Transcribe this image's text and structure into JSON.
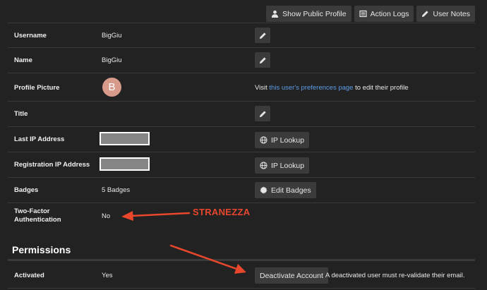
{
  "toolbar": {
    "show_public_profile": "Show Public Profile",
    "action_logs": "Action Logs",
    "user_notes": "User Notes"
  },
  "profile": {
    "username": {
      "label": "Username",
      "value": "BigGiu"
    },
    "name": {
      "label": "Name",
      "value": "BigGiu"
    },
    "picture": {
      "label": "Profile Picture",
      "avatar_letter": "B",
      "note_prefix": "Visit",
      "note_link": "this user's preferences page",
      "note_suffix": "to edit their profile"
    },
    "title": {
      "label": "Title",
      "value": ""
    },
    "last_ip": {
      "label": "Last IP Address",
      "lookup": "IP Lookup"
    },
    "registration_ip": {
      "label": "Registration IP Address",
      "lookup": "IP Lookup"
    },
    "badges": {
      "label": "Badges",
      "value": "5 Badges",
      "edit": "Edit Badges"
    },
    "two_factor": {
      "label": "Two-Factor Authentication",
      "value": "No"
    }
  },
  "annotation": {
    "text": "STRANEZZA",
    "color": "#e8472c"
  },
  "permissions": {
    "title": "Permissions",
    "activated": {
      "label": "Activated",
      "value": "Yes",
      "deactivate": "Deactivate Account",
      "note": "A deactivated user must re-validate their email."
    }
  },
  "colors": {
    "background": "#222222",
    "button": "#3b3b3b",
    "link": "#5c9ee6",
    "avatar": "#d79a8b"
  },
  "icons": [
    "user-icon",
    "list-icon",
    "pencil-icon",
    "globe-icon",
    "gear-icon"
  ]
}
